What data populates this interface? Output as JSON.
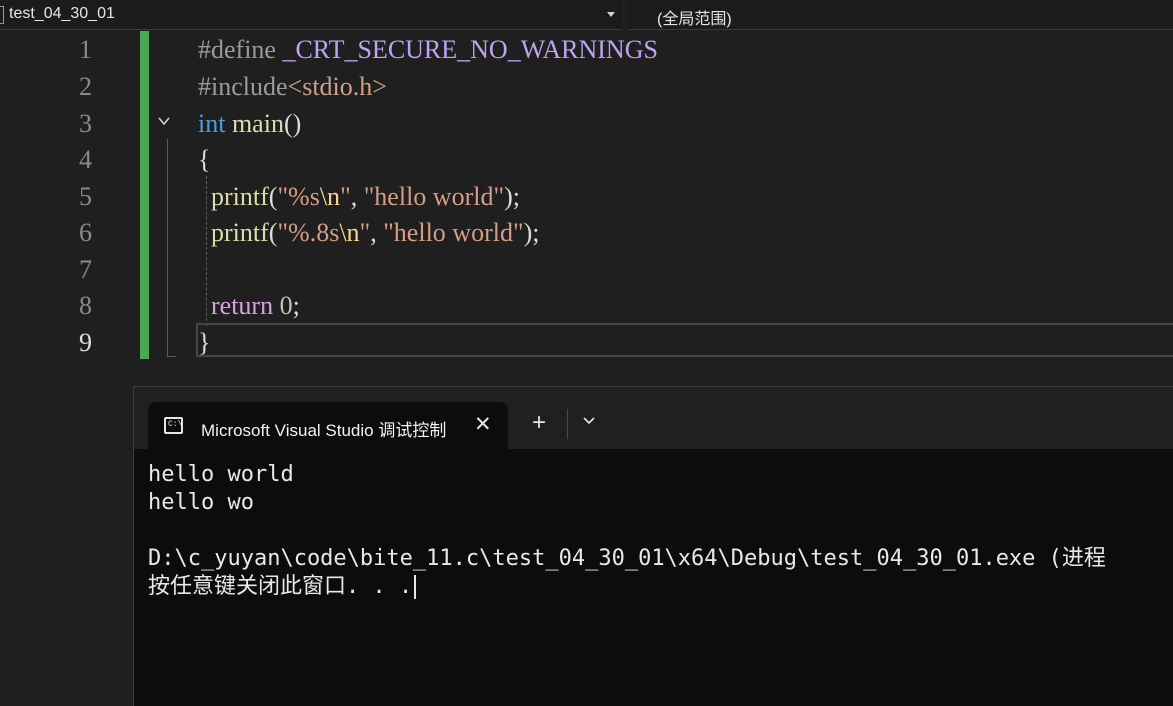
{
  "nav": {
    "project": "test_04_30_01",
    "scope": "(全局范围)"
  },
  "editor": {
    "line_numbers": [
      "1",
      "2",
      "3",
      "4",
      "5",
      "6",
      "7",
      "8",
      "9"
    ],
    "current_line": "9",
    "code": {
      "l1_directive": "#define",
      "l1_macro": "_CRT_SECURE_NO_WARNINGS",
      "l2_directive": "#include",
      "l2_header": "<stdio.h>",
      "l3_type": "int",
      "l3_name": "main",
      "l3_parens": "()",
      "l4_brace": "{",
      "l5_fn": "printf",
      "l5_open": "(",
      "l5_fmt_a": "\"%s",
      "l5_esc": "\\n",
      "l5_fmt_b": "\"",
      "l5_comma": ", ",
      "l5_str": "\"hello world\"",
      "l5_close": ");",
      "l6_fn": "printf",
      "l6_open": "(",
      "l6_fmt_a": "\"%.8s",
      "l6_esc": "\\n",
      "l6_fmt_b": "\"",
      "l6_comma": ", ",
      "l6_str": "\"hello world\"",
      "l6_close": ");",
      "l8_kw": "return",
      "l8_num": "0",
      "l8_semi": ";",
      "l9_brace": "}"
    }
  },
  "terminal": {
    "tab_icon_text": "C:\\",
    "tab_title": "Microsoft Visual Studio 调试控制台",
    "tab_close": "✕",
    "new_tab": "+",
    "output": [
      "hello world",
      "hello wo",
      "",
      "D:\\c_yuyan\\code\\bite_11.c\\test_04_30_01\\x64\\Debug\\test_04_30_01.exe (进程",
      "按任意键关闭此窗口. . ."
    ]
  }
}
